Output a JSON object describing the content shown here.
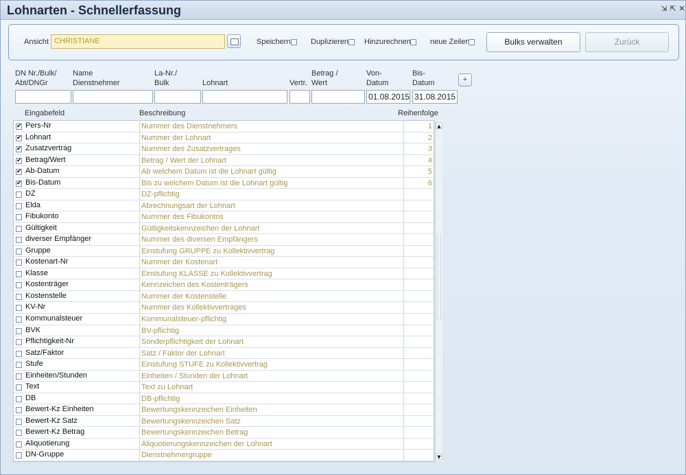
{
  "window": {
    "title": "Lohnarten - Schnellerfassung",
    "controls": [
      "⇲",
      "⇱",
      "✕"
    ]
  },
  "toolbar": {
    "ansicht_label": "Ansicht",
    "ansicht_value": "CHRISTIANE",
    "speichern_label": "Speichern",
    "duplizieren_label": "Duplizieren",
    "hinzurechnen_label": "Hinzurechnen",
    "neue_zeilen_label": "neue Zeilen",
    "bulks_button": "Bulks verwalten",
    "zurueck_button": "Zurück"
  },
  "entry": {
    "headers": {
      "dn": "DN Nr./Bulk/\nAbt/DNGr",
      "name": "Name\nDienstnehmer",
      "la": "La-Nr./\nBulk",
      "lohnart": "Lohnart",
      "vertr": "Vertr.",
      "betrag": "Betrag /\nWert",
      "von": "Von-\nDatum",
      "bis": "Bis-\nDatum"
    },
    "values": {
      "dn": "",
      "name": "",
      "la": "",
      "lohnart": "",
      "vertr": "",
      "betrag": "",
      "von": "01.08.2015",
      "bis": "31.08.2015"
    },
    "add_button": "+"
  },
  "grid": {
    "columns": {
      "field": "Eingabefeld",
      "desc": "Beschreibung",
      "order": "Reihenfolge"
    },
    "rows": [
      {
        "field": "Pers-Nr",
        "desc": "Nummer des Dienstnehmers",
        "order": "1",
        "checked": true
      },
      {
        "field": "Lohnart",
        "desc": "Nummer der Lohnart",
        "order": "2",
        "checked": true
      },
      {
        "field": "Zusatzvertrag",
        "desc": "Nummer des Zusatzvertrages",
        "order": "3",
        "checked": true
      },
      {
        "field": "Betrag/Wert",
        "desc": "Betrag / Wert der Lohnart",
        "order": "4",
        "checked": true
      },
      {
        "field": "Ab-Datum",
        "desc": "Ab welchem Datum ist die Lohnart gültig",
        "order": "5",
        "checked": true
      },
      {
        "field": "Bis-Datum",
        "desc": "Bis zu welchem Datum ist die Lohnart gültig",
        "order": "6",
        "checked": true
      },
      {
        "field": "DZ",
        "desc": "DZ-pflichtig",
        "order": "",
        "checked": false
      },
      {
        "field": "Elda",
        "desc": "Abrechnungsart der Lohnart",
        "order": "",
        "checked": false
      },
      {
        "field": "Fibukonto",
        "desc": "Nummer des Fibukontos",
        "order": "",
        "checked": false
      },
      {
        "field": "Gültigkeit",
        "desc": "Gültigkeitskennzeichen der Lohnart",
        "order": "",
        "checked": false
      },
      {
        "field": "diverser Empfänger",
        "desc": "Nummer des diversen Empfängers",
        "order": "",
        "checked": false
      },
      {
        "field": "Gruppe",
        "desc": "Einstufung GRUPPE zu Kollektivvertrag",
        "order": "",
        "checked": false
      },
      {
        "field": "Kostenart-Nr",
        "desc": "Nummer der Kostenart",
        "order": "",
        "checked": false
      },
      {
        "field": "Klasse",
        "desc": "Einstufung KLASSE zu Kollektivvertrag",
        "order": "",
        "checked": false
      },
      {
        "field": "Kostenträger",
        "desc": "Kennzeichen des Kostenträgers",
        "order": "",
        "checked": false
      },
      {
        "field": "Kostenstelle",
        "desc": "Nummer der Kostenstelle",
        "order": "",
        "checked": false
      },
      {
        "field": "KV-Nr",
        "desc": "Nummer des Kollektivvertrages",
        "order": "",
        "checked": false
      },
      {
        "field": "Kommunalsteuer",
        "desc": "Kommunalsteuer-pflichtig",
        "order": "",
        "checked": false
      },
      {
        "field": "BVK",
        "desc": "BV-pflichtig",
        "order": "",
        "checked": false
      },
      {
        "field": "Pflichtigkeit-Nr",
        "desc": "Sonderpflichtigkeit der Lohnart",
        "order": "",
        "checked": false
      },
      {
        "field": "Satz/Faktor",
        "desc": "Satz / Faktor der Lohnart",
        "order": "",
        "checked": false
      },
      {
        "field": "Stufe",
        "desc": "Einstufung STUFE zu Kollektivvertrag",
        "order": "",
        "checked": false
      },
      {
        "field": "Einheiten/Stunden",
        "desc": "Einheiten / Stunden der Lohnart",
        "order": "",
        "checked": false
      },
      {
        "field": "Text",
        "desc": "Text zu Lohnart",
        "order": "",
        "checked": false
      },
      {
        "field": "DB",
        "desc": "DB-pflichtig",
        "order": "",
        "checked": false
      },
      {
        "field": "Bewert-Kz Einheiten",
        "desc": "Bewertungskennzeichen Einheiten",
        "order": "",
        "checked": false
      },
      {
        "field": "Bewert-Kz Satz",
        "desc": "Bewertungskennzeichen Satz",
        "order": "",
        "checked": false
      },
      {
        "field": "Bewert-Kz Betrag",
        "desc": "Bewertungskennzeichen Betrag",
        "order": "",
        "checked": false
      },
      {
        "field": "Aliquotierung",
        "desc": "Aliquotierungskennzeichen der Lohnart",
        "order": "",
        "checked": false
      },
      {
        "field": "DN-Gruppe",
        "desc": "Dienstnehmergruppe",
        "order": "",
        "checked": false
      }
    ]
  },
  "colors": {
    "title_text": "#1c2b45",
    "description_text": "#a89652",
    "frame_border": "#7ea0cc",
    "ansicht_fill": "#fdf3c8"
  }
}
